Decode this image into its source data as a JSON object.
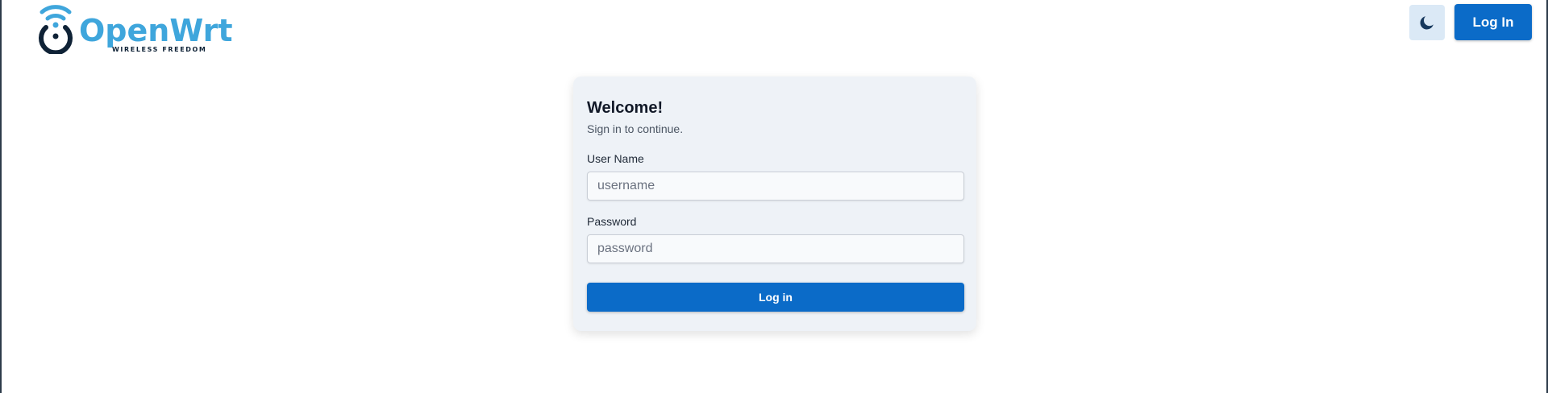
{
  "header": {
    "logo": {
      "wordmark": "OpenWrt",
      "tagline": "WIRELESS FREEDOM",
      "color": "#3fa6dc"
    },
    "theme_toggle_icon": "moon-icon",
    "login_label": "Log In"
  },
  "login_card": {
    "title": "Welcome!",
    "subtitle": "Sign in to continue.",
    "username": {
      "label": "User Name",
      "placeholder": "username",
      "value": ""
    },
    "password": {
      "label": "Password",
      "placeholder": "password",
      "value": ""
    },
    "submit_label": "Log in"
  },
  "colors": {
    "accent": "#0b6bc8",
    "card_background": "#eef2f7",
    "toggle_background": "#dbe9f6"
  }
}
